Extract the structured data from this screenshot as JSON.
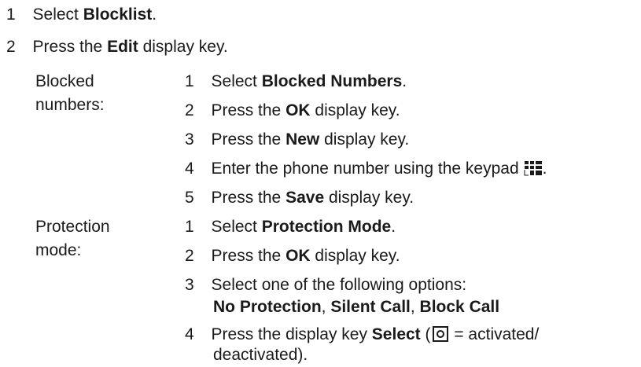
{
  "top_steps": [
    {
      "num": "1",
      "pre": "Select ",
      "bold": "Blocklist",
      "post": "."
    },
    {
      "num": "2",
      "pre": "Press the ",
      "bold": "Edit",
      "post": " display key."
    }
  ],
  "blocked": {
    "label_line1": "Blocked",
    "label_line2": "numbers:",
    "steps": [
      {
        "num": "1",
        "pre": "Select ",
        "bold": "Blocked Numbers",
        "post": "."
      },
      {
        "num": "2",
        "pre": "Press the ",
        "bold": "OK",
        "post": " display key."
      },
      {
        "num": "3",
        "pre": "Press the ",
        "bold": "New",
        "post": " display key."
      },
      {
        "num": "4",
        "pre": "Enter the phone number using the keypad",
        "post": "."
      },
      {
        "num": "5",
        "pre": "Press the ",
        "bold": "Save",
        "post": " display key."
      }
    ]
  },
  "protection": {
    "label_line1": "Protection",
    "label_line2": "mode:",
    "steps": [
      {
        "num": "1",
        "pre": "Select ",
        "bold": "Protection Mode",
        "post": "."
      },
      {
        "num": "2",
        "pre": "Press the ",
        "bold": "OK",
        "post": " display key."
      },
      {
        "num": "3",
        "pre": "Select one of the following options:"
      },
      {
        "num": "4",
        "pre": "Press the display key ",
        "bold": "Select",
        "paren_open": " (",
        "post": " = activated/",
        "post2": "deactivated)."
      }
    ],
    "options": [
      {
        "name": "No Protection",
        "sep": ", "
      },
      {
        "name": "Silent Call",
        "sep": ", "
      },
      {
        "name": "Block Call",
        "sep": ""
      }
    ]
  },
  "icons": {
    "keypad": "keypad-icon",
    "radio": "radio-button-icon"
  }
}
